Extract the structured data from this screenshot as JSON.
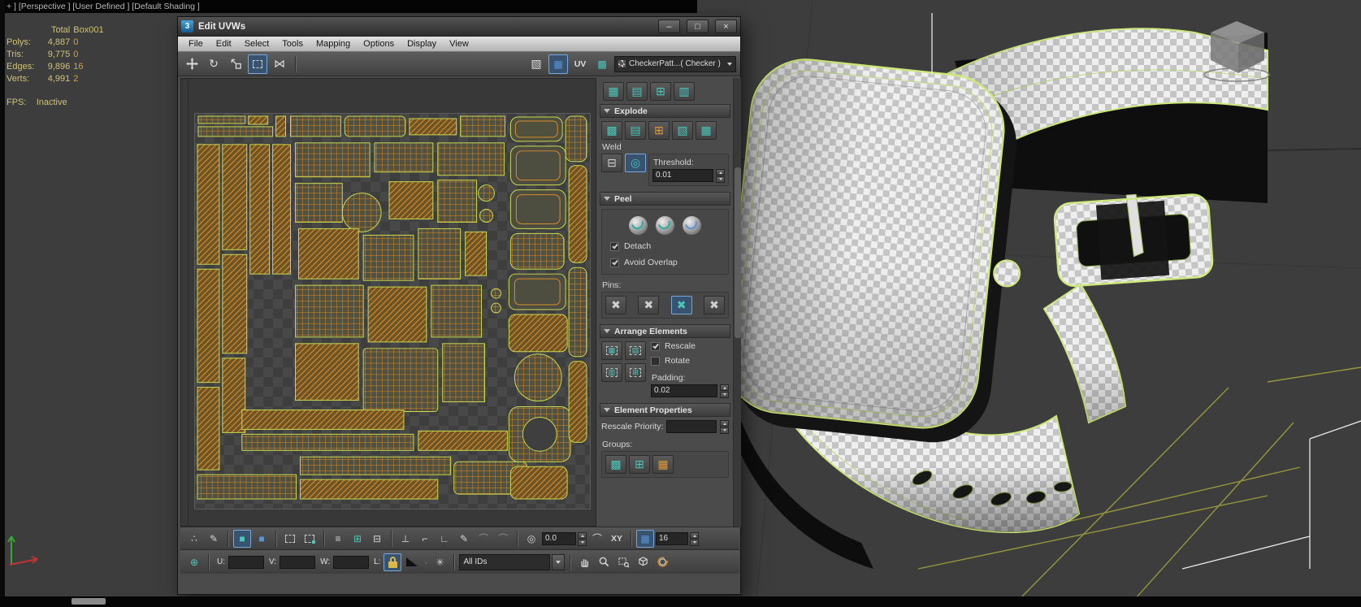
{
  "top_bar": {
    "viewport_label": "+ ] [Perspective ] [User Defined ] [Default Shading ]"
  },
  "stats": {
    "col_total": "Total",
    "col_object": "Box001",
    "rows": [
      {
        "label": "Polys:",
        "total": "4,887",
        "object": "0"
      },
      {
        "label": "Tris:",
        "total": "9,775",
        "object": "0"
      },
      {
        "label": "Edges:",
        "total": "9,896",
        "object": "16"
      },
      {
        "label": "Verts:",
        "total": "4,991",
        "object": "2"
      }
    ],
    "fps_label": "FPS:",
    "fps_value": "Inactive"
  },
  "editor": {
    "title": "Edit UVWs",
    "app_icon": "3",
    "menus": [
      "File",
      "Edit",
      "Select",
      "Tools",
      "Mapping",
      "Options",
      "Display",
      "View"
    ],
    "toolbar": {
      "uv_button": "UV",
      "texture_dropdown": "CheckerPatt...( Checker )"
    },
    "panel": {
      "explode": {
        "title": "Explode",
        "weld": "Weld",
        "threshold_label": "Threshold:",
        "threshold_value": "0.01"
      },
      "peel": {
        "title": "Peel",
        "detach": "Detach",
        "avoid_overlap": "Avoid Overlap",
        "pins": "Pins:"
      },
      "arrange": {
        "title": "Arrange Elements",
        "rescale": "Rescale",
        "rotate": "Rotate",
        "padding_label": "Padding:",
        "padding_value": "0.02"
      },
      "element_properties": {
        "title": "Element Properties",
        "rescale_priority_label": "Rescale Priority:",
        "rescale_priority_value": "",
        "groups": "Groups:"
      }
    },
    "transform_row": {
      "angle_value": "0.0",
      "axis_label": "XY",
      "grid_size": "16"
    },
    "status_row": {
      "u_label": "U:",
      "v_label": "V:",
      "w_label": "W:",
      "u_value": "",
      "v_value": "",
      "w_value": "",
      "l_label": "L:",
      "id_filter": "All IDs"
    }
  },
  "icons": {
    "grid": "▦",
    "grid_open": "▤",
    "grid_side": "▥",
    "grid_diag": "▧",
    "grid_dense": "▩",
    "grid_plus": "⊞",
    "grid_minus": "⊟",
    "square_filled": "■",
    "square_outline": "□",
    "target": "◎",
    "asterisk": "✳",
    "cross": "✖",
    "rotate": "↻",
    "mirror": "⋈",
    "dots": "∴",
    "pencil": "✎",
    "equals": "≡",
    "perp": "⊥",
    "angle": "∟",
    "corner": "⌐",
    "arc": "⌒",
    "plus_circle": "⊕",
    "minimize": "–",
    "maximize": "□",
    "close": "×",
    "checker": "▚"
  },
  "colors": {
    "seam_green": "#cde87c",
    "wire_orange": "#e0912e",
    "accent_teal": "#49c8ba",
    "stats_yellow": "#cfc27a"
  }
}
